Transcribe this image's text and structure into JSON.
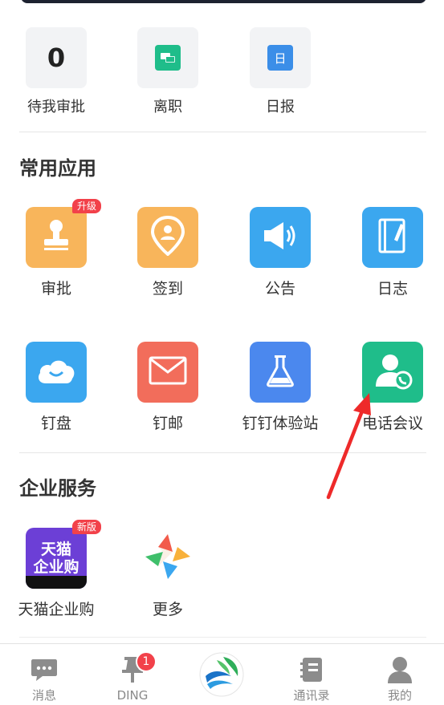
{
  "quick_actions": [
    {
      "count": "0",
      "label": "待我审批",
      "icon": "count"
    },
    {
      "label": "离职",
      "icon": "resign-chat-icon",
      "color": "#1fbd8a"
    },
    {
      "label": "日报",
      "icon": "daily-report-icon",
      "color": "#3b8ee8",
      "glyph": "日"
    }
  ],
  "common_apps": {
    "title": "常用应用",
    "items": [
      {
        "label": "审批",
        "icon": "stamp-icon",
        "color": "#f8b55b",
        "badge": "升级"
      },
      {
        "label": "签到",
        "icon": "location-pin-icon",
        "color": "#f8b55b"
      },
      {
        "label": "公告",
        "icon": "megaphone-icon",
        "color": "#3ba7ef"
      },
      {
        "label": "日志",
        "icon": "notebook-icon",
        "color": "#3ba7ef"
      },
      {
        "label": "钉盘",
        "icon": "cloud-icon",
        "color": "#3ba7ef"
      },
      {
        "label": "钉邮",
        "icon": "mail-icon",
        "color": "#f26d5b"
      },
      {
        "label": "钉钉体验站",
        "icon": "flask-icon",
        "color": "#4b88ee"
      },
      {
        "label": "电话会议",
        "icon": "phone-contact-icon",
        "color": "#1fbd8a"
      }
    ]
  },
  "enterprise_services": {
    "title": "企业服务",
    "items": [
      {
        "label": "天猫企业购",
        "icon": "tmall-icon",
        "color": "#6c3fd6",
        "badge": "新版",
        "tile_text_1": "天猫",
        "tile_text_2": "企业购"
      },
      {
        "label": "更多",
        "icon": "more-star-icon"
      }
    ]
  },
  "tabbar": [
    {
      "label": "消息",
      "icon": "chat-bubble-icon"
    },
    {
      "label": "DING",
      "icon": "pin-icon",
      "badge": "1"
    },
    {
      "label": "",
      "icon": "dingtalk-logo-icon"
    },
    {
      "label": "通讯录",
      "icon": "contacts-book-icon"
    },
    {
      "label": "我的",
      "icon": "user-icon"
    }
  ],
  "accent": "#f2414a"
}
